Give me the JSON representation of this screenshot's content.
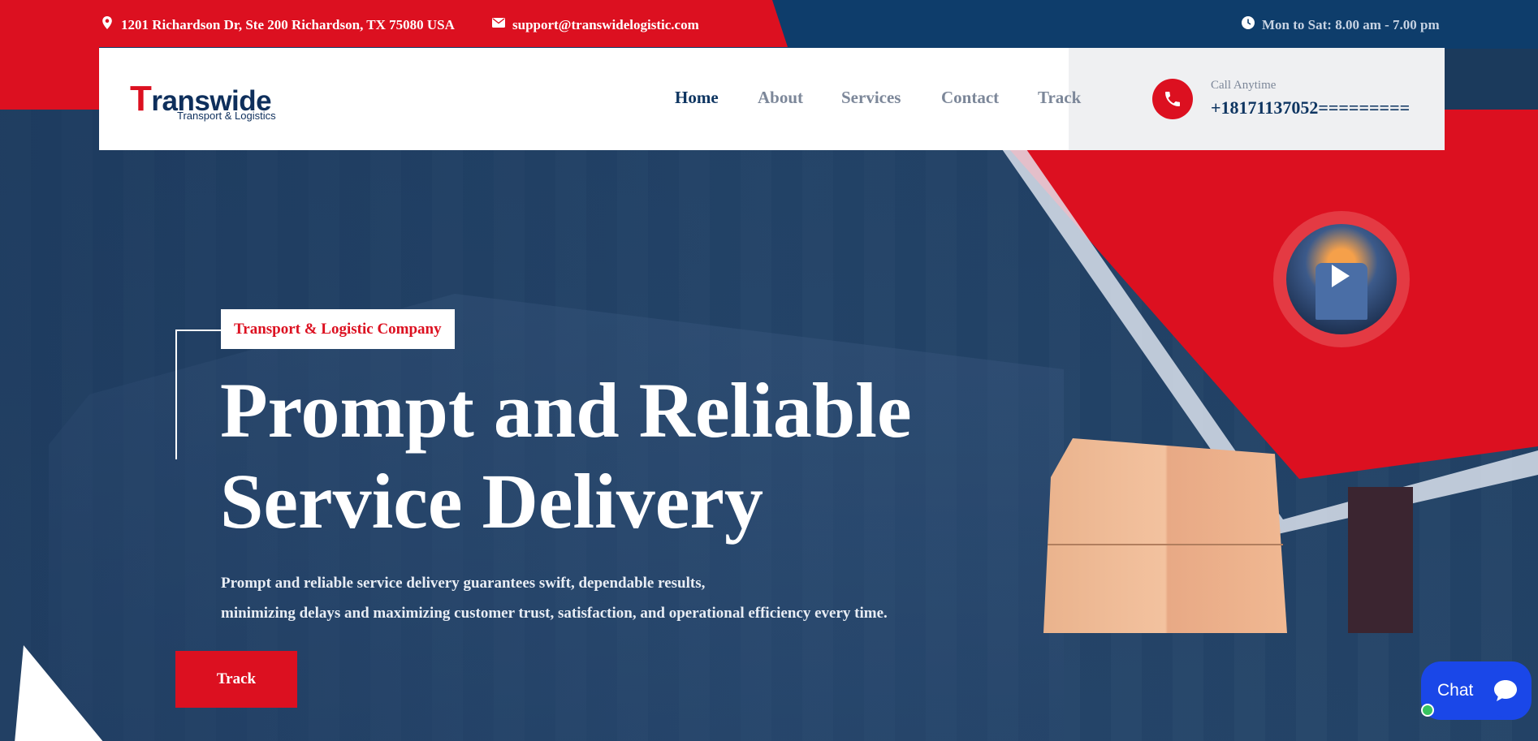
{
  "topbar": {
    "address": "1201 Richardson Dr, Ste 200 Richardson, TX 75080 USA",
    "email": "support@transwidelogistic.com",
    "hours": "Mon to Sat: 8.00 am - 7.00 pm"
  },
  "logo": {
    "first_letter": "T",
    "rest": "ranswide",
    "tagline": "Transport & Logistics"
  },
  "nav": {
    "home": "Home",
    "about": "About",
    "services": "Services",
    "contact": "Contact",
    "track": "Track"
  },
  "call": {
    "label": "Call Anytime",
    "number": "+18171137052========="
  },
  "hero": {
    "tag": "Transport & Logistic Company",
    "title_line1": "Prompt and Reliable",
    "title_line2": "Service Delivery",
    "text_line1": "Prompt and reliable service delivery guarantees swift, dependable results,",
    "text_line2": "minimizing delays and maximizing customer trust, satisfaction, and operational efficiency every time.",
    "button": "Track"
  },
  "chat": {
    "label": "Chat"
  },
  "colors": {
    "brand_red": "#dc1020",
    "navy": "#0e3561",
    "chat_blue": "#1a47e8"
  }
}
